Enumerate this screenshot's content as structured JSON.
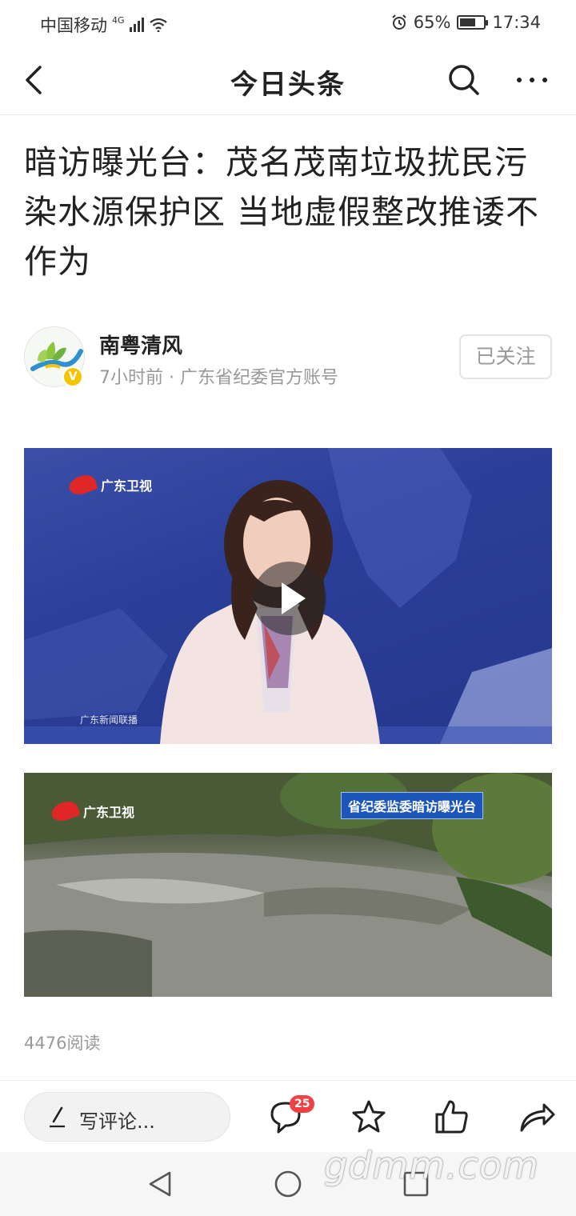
{
  "status": {
    "carrier": "中国移动",
    "network": "4G",
    "battery_percent": "65%",
    "battery_level": 0.65,
    "time": "17:34"
  },
  "header": {
    "title": "今日头条",
    "icons": [
      "back-icon",
      "search-icon",
      "more-icon"
    ]
  },
  "article": {
    "title": "暗访曝光台：茂名茂南垃圾扰民污染水源保护区 当地虚假整改推诿不作为",
    "author": {
      "name": "南粤清风",
      "meta": "7小时前 · 广东省纪委官方账号",
      "verified": "V",
      "follow_label": "已关注"
    },
    "video": {
      "channel_logo": "广东卫视",
      "program": "广东新闻联播"
    },
    "photo": {
      "channel_logo": "广东卫视",
      "banner": "省纪委监委暗访曝光台"
    },
    "read_count": "4476阅读"
  },
  "actions": {
    "comment_placeholder": "写评论...",
    "comment_count": "25",
    "icons": [
      "comment-icon",
      "favorite-star-icon",
      "like-thumb-icon",
      "share-icon"
    ]
  },
  "nav": {
    "icons": [
      "nav-back-icon",
      "nav-home-icon",
      "nav-recent-icon"
    ]
  },
  "watermark": "gdmm.com",
  "colors": {
    "badge": "#f04142",
    "verified": "#f5c400",
    "accent_text_muted": "#999999"
  }
}
